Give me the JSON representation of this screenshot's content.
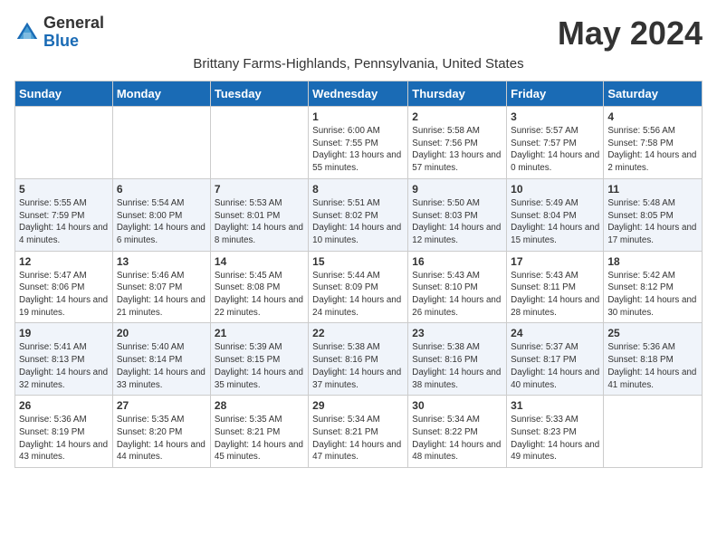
{
  "logo": {
    "general": "General",
    "blue": "Blue"
  },
  "title": "May 2024",
  "subtitle": "Brittany Farms-Highlands, Pennsylvania, United States",
  "days_of_week": [
    "Sunday",
    "Monday",
    "Tuesday",
    "Wednesday",
    "Thursday",
    "Friday",
    "Saturday"
  ],
  "weeks": [
    [
      {
        "day": "",
        "sunrise": "",
        "sunset": "",
        "daylight": ""
      },
      {
        "day": "",
        "sunrise": "",
        "sunset": "",
        "daylight": ""
      },
      {
        "day": "",
        "sunrise": "",
        "sunset": "",
        "daylight": ""
      },
      {
        "day": "1",
        "sunrise": "Sunrise: 6:00 AM",
        "sunset": "Sunset: 7:55 PM",
        "daylight": "Daylight: 13 hours and 55 minutes."
      },
      {
        "day": "2",
        "sunrise": "Sunrise: 5:58 AM",
        "sunset": "Sunset: 7:56 PM",
        "daylight": "Daylight: 13 hours and 57 minutes."
      },
      {
        "day": "3",
        "sunrise": "Sunrise: 5:57 AM",
        "sunset": "Sunset: 7:57 PM",
        "daylight": "Daylight: 14 hours and 0 minutes."
      },
      {
        "day": "4",
        "sunrise": "Sunrise: 5:56 AM",
        "sunset": "Sunset: 7:58 PM",
        "daylight": "Daylight: 14 hours and 2 minutes."
      }
    ],
    [
      {
        "day": "5",
        "sunrise": "Sunrise: 5:55 AM",
        "sunset": "Sunset: 7:59 PM",
        "daylight": "Daylight: 14 hours and 4 minutes."
      },
      {
        "day": "6",
        "sunrise": "Sunrise: 5:54 AM",
        "sunset": "Sunset: 8:00 PM",
        "daylight": "Daylight: 14 hours and 6 minutes."
      },
      {
        "day": "7",
        "sunrise": "Sunrise: 5:53 AM",
        "sunset": "Sunset: 8:01 PM",
        "daylight": "Daylight: 14 hours and 8 minutes."
      },
      {
        "day": "8",
        "sunrise": "Sunrise: 5:51 AM",
        "sunset": "Sunset: 8:02 PM",
        "daylight": "Daylight: 14 hours and 10 minutes."
      },
      {
        "day": "9",
        "sunrise": "Sunrise: 5:50 AM",
        "sunset": "Sunset: 8:03 PM",
        "daylight": "Daylight: 14 hours and 12 minutes."
      },
      {
        "day": "10",
        "sunrise": "Sunrise: 5:49 AM",
        "sunset": "Sunset: 8:04 PM",
        "daylight": "Daylight: 14 hours and 15 minutes."
      },
      {
        "day": "11",
        "sunrise": "Sunrise: 5:48 AM",
        "sunset": "Sunset: 8:05 PM",
        "daylight": "Daylight: 14 hours and 17 minutes."
      }
    ],
    [
      {
        "day": "12",
        "sunrise": "Sunrise: 5:47 AM",
        "sunset": "Sunset: 8:06 PM",
        "daylight": "Daylight: 14 hours and 19 minutes."
      },
      {
        "day": "13",
        "sunrise": "Sunrise: 5:46 AM",
        "sunset": "Sunset: 8:07 PM",
        "daylight": "Daylight: 14 hours and 21 minutes."
      },
      {
        "day": "14",
        "sunrise": "Sunrise: 5:45 AM",
        "sunset": "Sunset: 8:08 PM",
        "daylight": "Daylight: 14 hours and 22 minutes."
      },
      {
        "day": "15",
        "sunrise": "Sunrise: 5:44 AM",
        "sunset": "Sunset: 8:09 PM",
        "daylight": "Daylight: 14 hours and 24 minutes."
      },
      {
        "day": "16",
        "sunrise": "Sunrise: 5:43 AM",
        "sunset": "Sunset: 8:10 PM",
        "daylight": "Daylight: 14 hours and 26 minutes."
      },
      {
        "day": "17",
        "sunrise": "Sunrise: 5:43 AM",
        "sunset": "Sunset: 8:11 PM",
        "daylight": "Daylight: 14 hours and 28 minutes."
      },
      {
        "day": "18",
        "sunrise": "Sunrise: 5:42 AM",
        "sunset": "Sunset: 8:12 PM",
        "daylight": "Daylight: 14 hours and 30 minutes."
      }
    ],
    [
      {
        "day": "19",
        "sunrise": "Sunrise: 5:41 AM",
        "sunset": "Sunset: 8:13 PM",
        "daylight": "Daylight: 14 hours and 32 minutes."
      },
      {
        "day": "20",
        "sunrise": "Sunrise: 5:40 AM",
        "sunset": "Sunset: 8:14 PM",
        "daylight": "Daylight: 14 hours and 33 minutes."
      },
      {
        "day": "21",
        "sunrise": "Sunrise: 5:39 AM",
        "sunset": "Sunset: 8:15 PM",
        "daylight": "Daylight: 14 hours and 35 minutes."
      },
      {
        "day": "22",
        "sunrise": "Sunrise: 5:38 AM",
        "sunset": "Sunset: 8:16 PM",
        "daylight": "Daylight: 14 hours and 37 minutes."
      },
      {
        "day": "23",
        "sunrise": "Sunrise: 5:38 AM",
        "sunset": "Sunset: 8:16 PM",
        "daylight": "Daylight: 14 hours and 38 minutes."
      },
      {
        "day": "24",
        "sunrise": "Sunrise: 5:37 AM",
        "sunset": "Sunset: 8:17 PM",
        "daylight": "Daylight: 14 hours and 40 minutes."
      },
      {
        "day": "25",
        "sunrise": "Sunrise: 5:36 AM",
        "sunset": "Sunset: 8:18 PM",
        "daylight": "Daylight: 14 hours and 41 minutes."
      }
    ],
    [
      {
        "day": "26",
        "sunrise": "Sunrise: 5:36 AM",
        "sunset": "Sunset: 8:19 PM",
        "daylight": "Daylight: 14 hours and 43 minutes."
      },
      {
        "day": "27",
        "sunrise": "Sunrise: 5:35 AM",
        "sunset": "Sunset: 8:20 PM",
        "daylight": "Daylight: 14 hours and 44 minutes."
      },
      {
        "day": "28",
        "sunrise": "Sunrise: 5:35 AM",
        "sunset": "Sunset: 8:21 PM",
        "daylight": "Daylight: 14 hours and 45 minutes."
      },
      {
        "day": "29",
        "sunrise": "Sunrise: 5:34 AM",
        "sunset": "Sunset: 8:21 PM",
        "daylight": "Daylight: 14 hours and 47 minutes."
      },
      {
        "day": "30",
        "sunrise": "Sunrise: 5:34 AM",
        "sunset": "Sunset: 8:22 PM",
        "daylight": "Daylight: 14 hours and 48 minutes."
      },
      {
        "day": "31",
        "sunrise": "Sunrise: 5:33 AM",
        "sunset": "Sunset: 8:23 PM",
        "daylight": "Daylight: 14 hours and 49 minutes."
      },
      {
        "day": "",
        "sunrise": "",
        "sunset": "",
        "daylight": ""
      }
    ]
  ]
}
